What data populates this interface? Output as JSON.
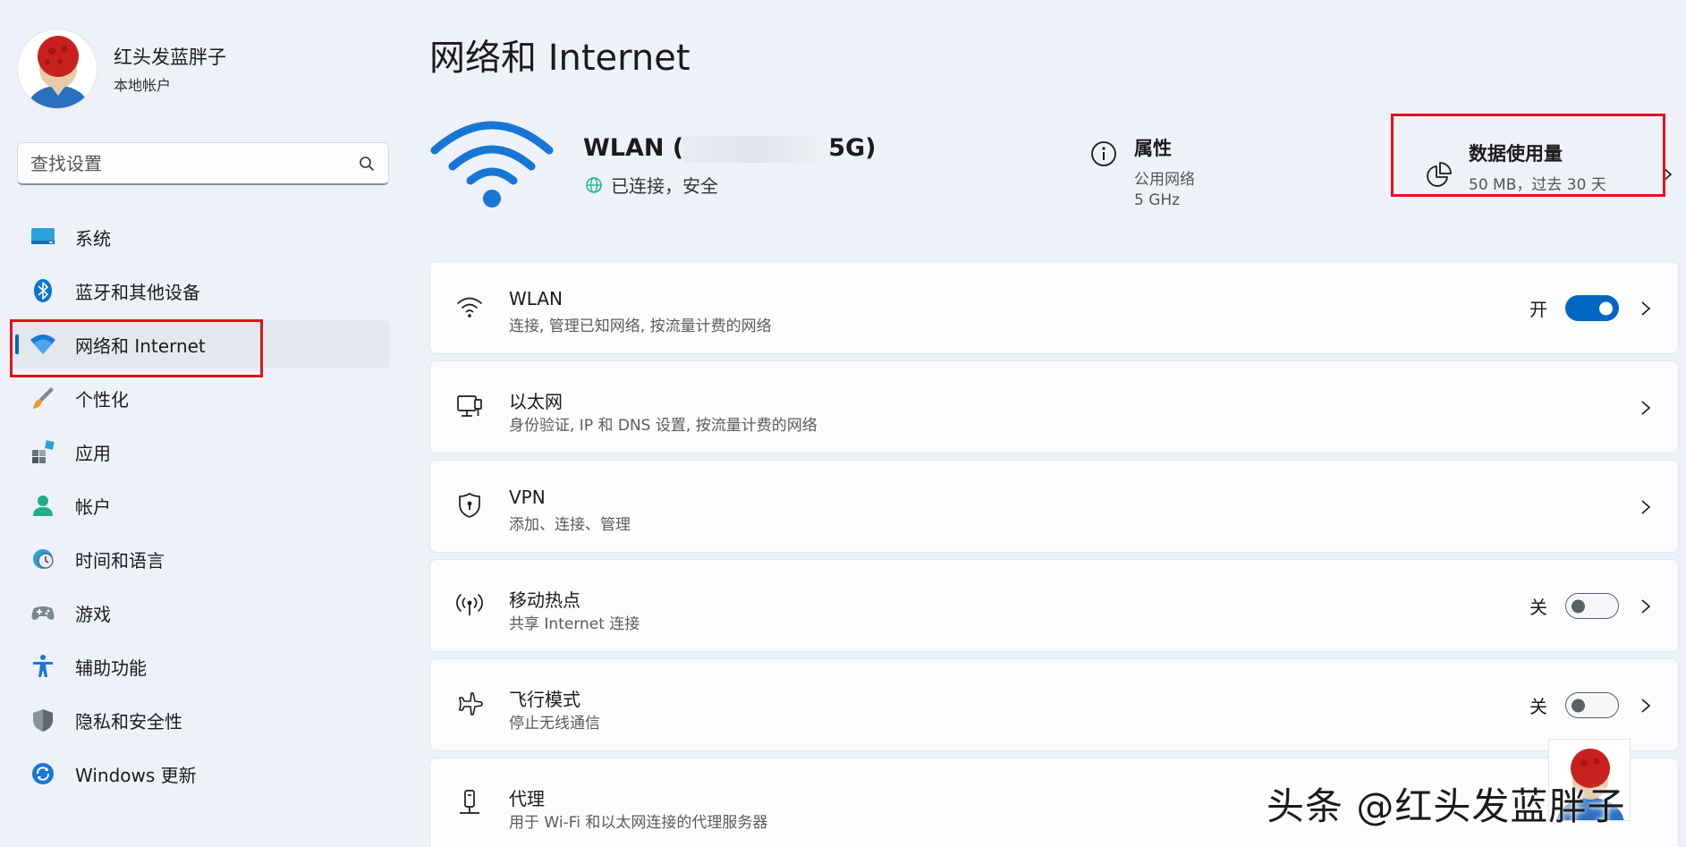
{
  "profile": {
    "name": "红头发蓝胖子",
    "account_type": "本地帐户"
  },
  "search": {
    "placeholder": "查找设置"
  },
  "sidebar": {
    "items": [
      {
        "label": "系统",
        "icon": "monitor-icon"
      },
      {
        "label": "蓝牙和其他设备",
        "icon": "bluetooth-icon"
      },
      {
        "label": "网络和 Internet",
        "icon": "wifi-icon",
        "active": true
      },
      {
        "label": "个性化",
        "icon": "brush-icon"
      },
      {
        "label": "应用",
        "icon": "apps-icon"
      },
      {
        "label": "帐户",
        "icon": "person-icon"
      },
      {
        "label": "时间和语言",
        "icon": "clock-globe-icon"
      },
      {
        "label": "游戏",
        "icon": "gamepad-icon"
      },
      {
        "label": "辅助功能",
        "icon": "accessibility-icon"
      },
      {
        "label": "隐私和安全性",
        "icon": "shield-icon"
      },
      {
        "label": "Windows 更新",
        "icon": "update-icon"
      }
    ]
  },
  "page": {
    "title": "网络和 Internet"
  },
  "connection": {
    "name_prefix": "WLAN (",
    "name_suffix": "5G)",
    "status": "已连接，安全"
  },
  "properties": {
    "title": "属性",
    "network_type": "公用网络",
    "band": "5 GHz"
  },
  "data_usage": {
    "title": "数据使用量",
    "summary": "50 MB，过去 30 天"
  },
  "settings": [
    {
      "title": "WLAN",
      "subtitle": "连接, 管理已知网络, 按流量计费的网络",
      "icon": "wifi-icon",
      "toggle": "开"
    },
    {
      "title": "以太网",
      "subtitle": "身份验证, IP 和 DNS 设置, 按流量计费的网络",
      "icon": "ethernet-icon"
    },
    {
      "title": "VPN",
      "subtitle": "添加、连接、管理",
      "icon": "vpn-shield-icon"
    },
    {
      "title": "移动热点",
      "subtitle": "共享 Internet 连接",
      "icon": "hotspot-icon",
      "toggle": "关"
    },
    {
      "title": "飞行模式",
      "subtitle": "停止无线通信",
      "icon": "airplane-icon",
      "toggle": "关"
    },
    {
      "title": "代理",
      "subtitle": "用于 Wi-Fi 和以太网连接的代理服务器",
      "icon": "proxy-icon"
    }
  ],
  "watermark": {
    "text": "头条 @红头发蓝胖子"
  },
  "colors": {
    "accent": "#0067c0",
    "highlight": "#e3121b",
    "background": "#eef2f8"
  }
}
